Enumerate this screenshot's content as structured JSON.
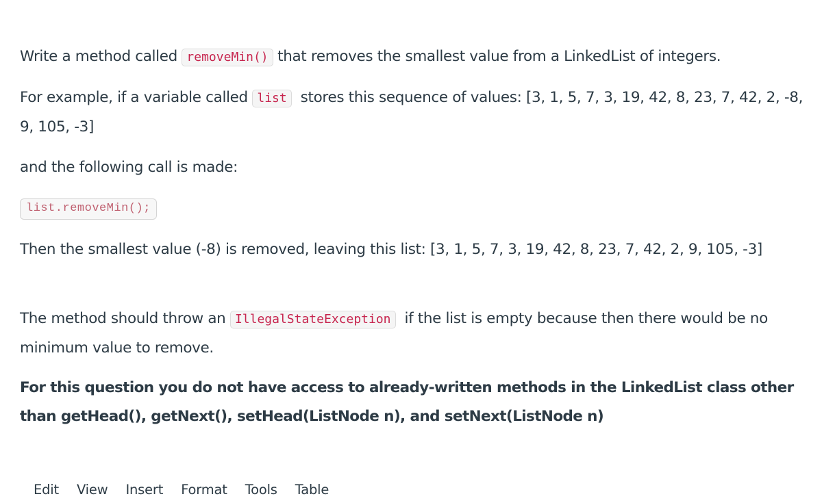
{
  "question": {
    "p1": {
      "before": "Write a method called ",
      "code": "removeMin()",
      "after": " that removes the smallest value from a LinkedList of integers."
    },
    "p2": {
      "before": "For example, if a variable called ",
      "code": "list",
      "after": "  stores this sequence of values: [3, 1, 5, 7, 3, 19, 42, 8, 23, 7, 42, 2, -8, 9, 105, -3]"
    },
    "p3": "and the following call is made:",
    "code_block": "list.removeMin();",
    "p4": "Then the smallest value (-8) is removed, leaving this list: [3, 1, 5, 7, 3, 19, 42, 8, 23, 7, 42, 2, 9, 105, -3]",
    "p5": {
      "before": "The method should throw an ",
      "code": "IllegalStateException",
      "after": "  if the list is empty because then there would be no minimum value to remove."
    },
    "p6": "For this question you do not have access to already-written methods in the LinkedList class other than getHead(), getNext(), setHead(ListNode n), and setNext(ListNode n)"
  },
  "editor_menu": {
    "items": [
      "Edit",
      "View",
      "Insert",
      "Format",
      "Tools",
      "Table"
    ]
  }
}
